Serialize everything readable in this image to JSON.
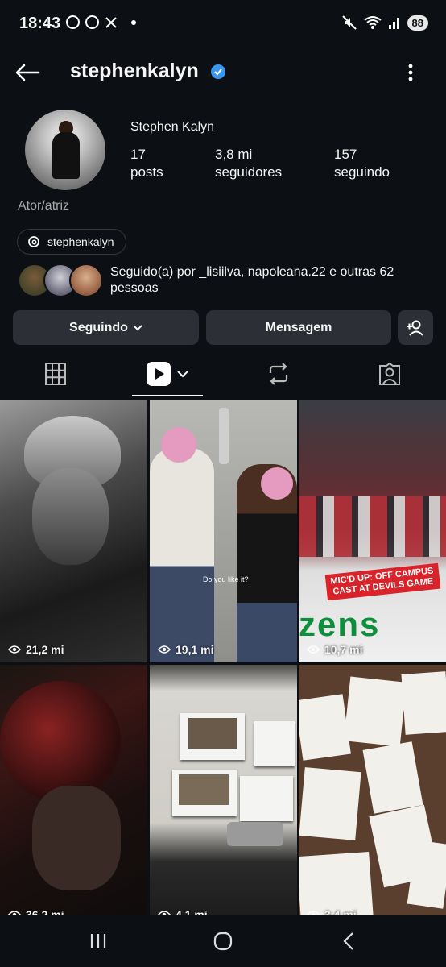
{
  "status_bar": {
    "time": "18:43",
    "battery": "88"
  },
  "header": {
    "username": "stephenkalyn"
  },
  "profile": {
    "full_name": "Stephen Kalyn",
    "stats": [
      {
        "number": "17",
        "label": "posts"
      },
      {
        "number": "3,8 mi",
        "label": "seguidores"
      },
      {
        "number": "157",
        "label": "seguindo"
      }
    ],
    "category": "Ator/atriz",
    "threads_handle": "stephenkalyn",
    "followed_by": "Seguido(a) por _lisiilva, napoleana.22 e outras 62 pessoas"
  },
  "actions": {
    "following_label": "Seguindo",
    "message_label": "Mensagem"
  },
  "grid": [
    {
      "views": "21,2 mi"
    },
    {
      "views": "19,1 mi",
      "subtitle": "Do you like it?"
    },
    {
      "views": "10,7 mi",
      "caption": "MIC'D UP: OFF CAMPUS\nCAST AT DEVILS GAME",
      "sign": "zens"
    },
    {
      "views": "36,2 mi"
    },
    {
      "views": "4,1 mi"
    },
    {
      "views": "3,4 mi"
    }
  ]
}
